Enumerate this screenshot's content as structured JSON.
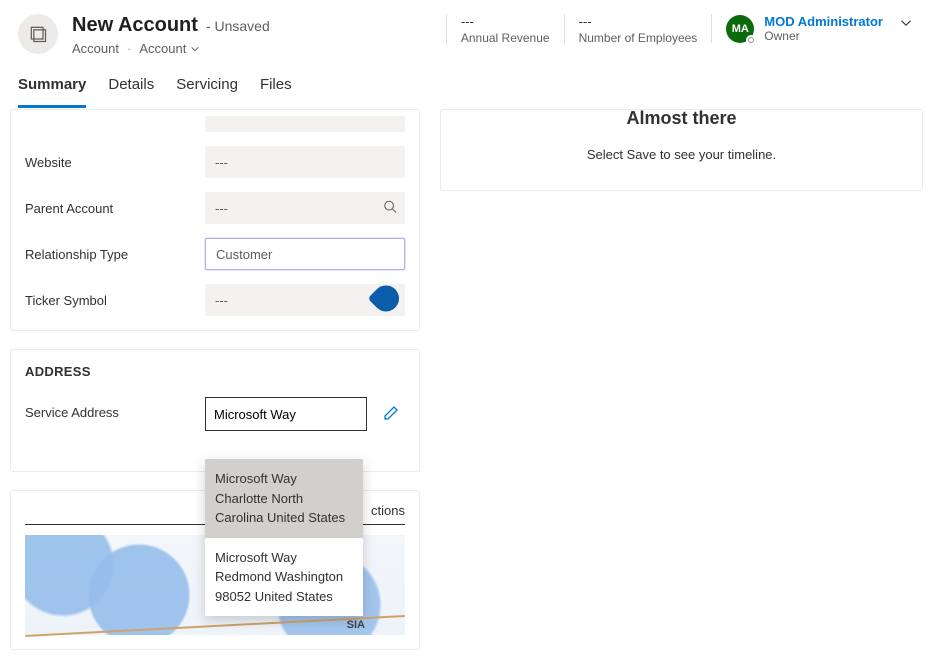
{
  "header": {
    "title": "New Account",
    "status": "- Unsaved",
    "entity": "Account",
    "form_selector": "Account",
    "stats": {
      "annual_revenue": {
        "value": "---",
        "label": "Annual Revenue"
      },
      "num_employees": {
        "value": "---",
        "label": "Number of Employees"
      }
    },
    "owner": {
      "initials": "MA",
      "name": "MOD Administrator",
      "label": "Owner"
    }
  },
  "tabs": {
    "summary": "Summary",
    "details": "Details",
    "servicing": "Servicing",
    "files": "Files"
  },
  "fields": {
    "website": {
      "label": "Website",
      "value": "---"
    },
    "parent_account": {
      "label": "Parent Account",
      "value": "---"
    },
    "relationship_type": {
      "label": "Relationship Type",
      "value": "Customer"
    },
    "ticker_symbol": {
      "label": "Ticker Symbol",
      "value": "---"
    }
  },
  "address_section": {
    "heading": "ADDRESS",
    "service_address_label": "Service Address",
    "input_value": "Microsoft Way",
    "suggestions": [
      "Microsoft Way Charlotte North Carolina United States",
      "Microsoft Way Redmond Washington 98052 United States"
    ]
  },
  "map": {
    "tab_label": "ctions",
    "road_label": "SIA"
  },
  "timeline": {
    "title": "Almost there",
    "subtitle": "Select Save to see your timeline."
  }
}
